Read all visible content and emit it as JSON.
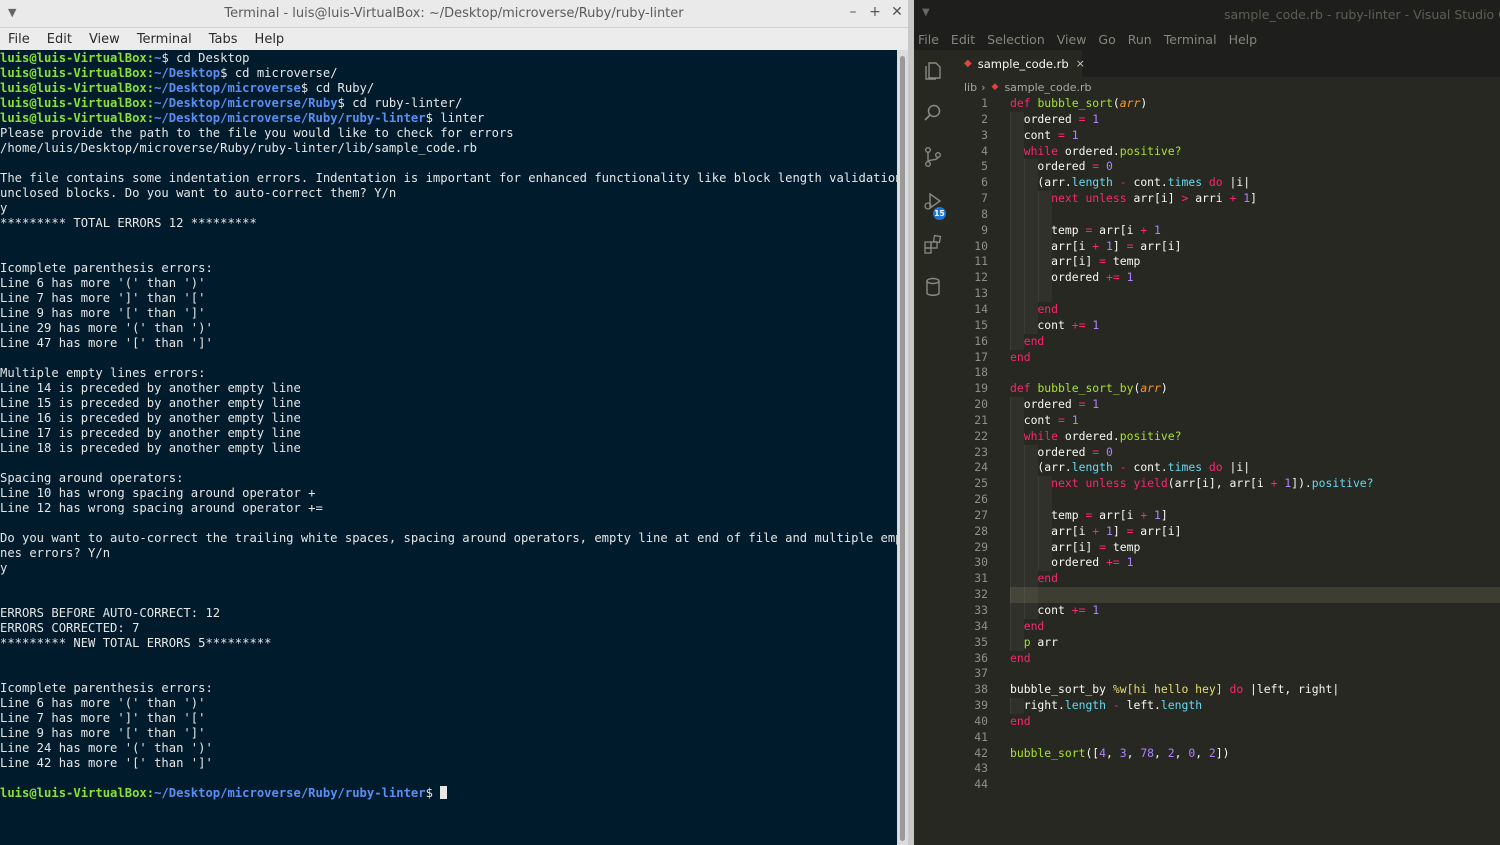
{
  "terminal": {
    "title": "Terminal - luis@luis-VirtualBox: ~/Desktop/microverse/Ruby/ruby-linter",
    "menu": [
      "File",
      "Edit",
      "View",
      "Terminal",
      "Tabs",
      "Help"
    ],
    "lines": [
      {
        "type": "prompt",
        "user": "luis@luis-VirtualBox",
        "path": "~",
        "cmd": "cd Desktop"
      },
      {
        "type": "prompt",
        "user": "luis@luis-VirtualBox",
        "path": "~/Desktop",
        "cmd": "cd microverse/"
      },
      {
        "type": "prompt",
        "user": "luis@luis-VirtualBox",
        "path": "~/Desktop/microverse",
        "cmd": "cd Ruby/"
      },
      {
        "type": "prompt",
        "user": "luis@luis-VirtualBox",
        "path": "~/Desktop/microverse/Ruby",
        "cmd": "cd ruby-linter/"
      },
      {
        "type": "prompt",
        "user": "luis@luis-VirtualBox",
        "path": "~/Desktop/microverse/Ruby/ruby-linter",
        "cmd": "linter"
      },
      {
        "type": "text",
        "text": "Please provide the path to the file you would like to check for errors"
      },
      {
        "type": "text",
        "text": "/home/luis/Desktop/microverse/Ruby/ruby-linter/lib/sample_code.rb"
      },
      {
        "type": "text",
        "text": ""
      },
      {
        "type": "text",
        "text": "The file contains some indentation errors. Indentation is important for enhanced functionality like block length validation and"
      },
      {
        "type": "text",
        "text": "unclosed blocks. Do you want to auto-correct them? Y/n"
      },
      {
        "type": "text",
        "text": "y"
      },
      {
        "type": "text",
        "text": "********* TOTAL ERRORS 12 *********"
      },
      {
        "type": "text",
        "text": ""
      },
      {
        "type": "text",
        "text": ""
      },
      {
        "type": "text",
        "text": "Icomplete parenthesis errors:"
      },
      {
        "type": "text",
        "text": "Line 6 has more '(' than ')'"
      },
      {
        "type": "text",
        "text": "Line 7 has more ']' than '['"
      },
      {
        "type": "text",
        "text": "Line 9 has more '[' than ']'"
      },
      {
        "type": "text",
        "text": "Line 29 has more '(' than ')'"
      },
      {
        "type": "text",
        "text": "Line 47 has more '[' than ']'"
      },
      {
        "type": "text",
        "text": ""
      },
      {
        "type": "text",
        "text": "Multiple empty lines errors:"
      },
      {
        "type": "text",
        "text": "Line 14 is preceded by another empty line"
      },
      {
        "type": "text",
        "text": "Line 15 is preceded by another empty line"
      },
      {
        "type": "text",
        "text": "Line 16 is preceded by another empty line"
      },
      {
        "type": "text",
        "text": "Line 17 is preceded by another empty line"
      },
      {
        "type": "text",
        "text": "Line 18 is preceded by another empty line"
      },
      {
        "type": "text",
        "text": ""
      },
      {
        "type": "text",
        "text": "Spacing around operators:"
      },
      {
        "type": "text",
        "text": "Line 10 has wrong spacing around operator +"
      },
      {
        "type": "text",
        "text": "Line 12 has wrong spacing around operator +="
      },
      {
        "type": "text",
        "text": ""
      },
      {
        "type": "text",
        "text": "Do you want to auto-correct the trailing white spaces, spacing around operators, empty line at end of file and multiple empty li"
      },
      {
        "type": "text",
        "text": "nes errors? Y/n"
      },
      {
        "type": "text",
        "text": "y"
      },
      {
        "type": "text",
        "text": ""
      },
      {
        "type": "text",
        "text": ""
      },
      {
        "type": "text",
        "text": "ERRORS BEFORE AUTO-CORRECT: 12"
      },
      {
        "type": "text",
        "text": "ERRORS CORRECTED: 7"
      },
      {
        "type": "text",
        "text": "********* NEW TOTAL ERRORS 5*********"
      },
      {
        "type": "text",
        "text": ""
      },
      {
        "type": "text",
        "text": ""
      },
      {
        "type": "text",
        "text": "Icomplete parenthesis errors:"
      },
      {
        "type": "text",
        "text": "Line 6 has more '(' than ')'"
      },
      {
        "type": "text",
        "text": "Line 7 has more ']' than '['"
      },
      {
        "type": "text",
        "text": "Line 9 has more '[' than ']'"
      },
      {
        "type": "text",
        "text": "Line 24 has more '(' than ')'"
      },
      {
        "type": "text",
        "text": "Line 42 has more '[' than ']'"
      },
      {
        "type": "text",
        "text": ""
      },
      {
        "type": "prompt",
        "user": "luis@luis-VirtualBox",
        "path": "~/Desktop/microverse/Ruby/ruby-linter",
        "cmd": "",
        "cursor": true
      }
    ]
  },
  "vscode": {
    "title": "sample_code.rb - ruby-linter - Visual Studio Co",
    "menu": [
      "File",
      "Edit",
      "Selection",
      "View",
      "Go",
      "Run",
      "Terminal",
      "Help"
    ],
    "tab": {
      "name": "sample_code.rb",
      "close": "×"
    },
    "breadcrumbs": {
      "folder": "lib",
      "file": "sample_code.rb"
    },
    "source_control_badge": "15",
    "current_line": 32,
    "code_lines": [
      [
        {
          "t": "def ",
          "c": "kw"
        },
        {
          "t": "bubble_sort",
          "c": "fn"
        },
        {
          "t": "("
        },
        {
          "t": "arr",
          "c": "pa"
        },
        {
          "t": ")"
        }
      ],
      [
        {
          "t": "  ordered "
        },
        {
          "t": "=",
          "c": "op"
        },
        {
          "t": " "
        },
        {
          "t": "1",
          "c": "nu"
        }
      ],
      [
        {
          "t": "  cont "
        },
        {
          "t": "=",
          "c": "op"
        },
        {
          "t": " "
        },
        {
          "t": "1",
          "c": "nu"
        }
      ],
      [
        {
          "t": "  "
        },
        {
          "t": "while",
          "c": "kw"
        },
        {
          "t": " ordered."
        },
        {
          "t": "positive?",
          "c": "fn"
        }
      ],
      [
        {
          "t": "    ordered "
        },
        {
          "t": "=",
          "c": "op"
        },
        {
          "t": " "
        },
        {
          "t": "0",
          "c": "nu"
        }
      ],
      [
        {
          "t": "    (arr."
        },
        {
          "t": "length",
          "c": "me"
        },
        {
          "t": " "
        },
        {
          "t": "-",
          "c": "op"
        },
        {
          "t": " cont."
        },
        {
          "t": "times",
          "c": "me"
        },
        {
          "t": " "
        },
        {
          "t": "do",
          "c": "kw"
        },
        {
          "t": " |i|"
        }
      ],
      [
        {
          "t": "      "
        },
        {
          "t": "next",
          "c": "kw"
        },
        {
          "t": " "
        },
        {
          "t": "unless",
          "c": "kw"
        },
        {
          "t": " arr[i] "
        },
        {
          "t": ">",
          "c": "op"
        },
        {
          "t": " arri "
        },
        {
          "t": "+",
          "c": "op"
        },
        {
          "t": " "
        },
        {
          "t": "1",
          "c": "nu"
        },
        {
          "t": "]"
        }
      ],
      [
        {
          "t": ""
        }
      ],
      [
        {
          "t": "      temp "
        },
        {
          "t": "=",
          "c": "op"
        },
        {
          "t": " arr[i "
        },
        {
          "t": "+",
          "c": "op"
        },
        {
          "t": " "
        },
        {
          "t": "1",
          "c": "nu"
        }
      ],
      [
        {
          "t": "      arr[i "
        },
        {
          "t": "+",
          "c": "op"
        },
        {
          "t": " "
        },
        {
          "t": "1",
          "c": "nu"
        },
        {
          "t": "] "
        },
        {
          "t": "=",
          "c": "op"
        },
        {
          "t": " arr[i]"
        }
      ],
      [
        {
          "t": "      arr[i] "
        },
        {
          "t": "=",
          "c": "op"
        },
        {
          "t": " temp"
        }
      ],
      [
        {
          "t": "      ordered "
        },
        {
          "t": "+=",
          "c": "op"
        },
        {
          "t": " "
        },
        {
          "t": "1",
          "c": "nu"
        }
      ],
      [
        {
          "t": ""
        }
      ],
      [
        {
          "t": "    "
        },
        {
          "t": "end",
          "c": "kw"
        }
      ],
      [
        {
          "t": "    cont "
        },
        {
          "t": "+=",
          "c": "op"
        },
        {
          "t": " "
        },
        {
          "t": "1",
          "c": "nu"
        }
      ],
      [
        {
          "t": "  "
        },
        {
          "t": "end",
          "c": "kw"
        }
      ],
      [
        {
          "t": "end",
          "c": "kw"
        }
      ],
      [
        {
          "t": ""
        }
      ],
      [
        {
          "t": "def ",
          "c": "kw"
        },
        {
          "t": "bubble_sort_by",
          "c": "fn"
        },
        {
          "t": "("
        },
        {
          "t": "arr",
          "c": "pa"
        },
        {
          "t": ")"
        }
      ],
      [
        {
          "t": "  ordered "
        },
        {
          "t": "=",
          "c": "op"
        },
        {
          "t": " "
        },
        {
          "t": "1",
          "c": "nu"
        }
      ],
      [
        {
          "t": "  cont "
        },
        {
          "t": "=",
          "c": "op"
        },
        {
          "t": " "
        },
        {
          "t": "1",
          "c": "nu"
        }
      ],
      [
        {
          "t": "  "
        },
        {
          "t": "while",
          "c": "kw"
        },
        {
          "t": " ordered."
        },
        {
          "t": "positive?",
          "c": "fn"
        }
      ],
      [
        {
          "t": "    ordered "
        },
        {
          "t": "=",
          "c": "op"
        },
        {
          "t": " "
        },
        {
          "t": "0",
          "c": "nu"
        }
      ],
      [
        {
          "t": "    (arr."
        },
        {
          "t": "length",
          "c": "me"
        },
        {
          "t": " "
        },
        {
          "t": "-",
          "c": "op"
        },
        {
          "t": " cont."
        },
        {
          "t": "times",
          "c": "me"
        },
        {
          "t": " "
        },
        {
          "t": "do",
          "c": "kw"
        },
        {
          "t": " |i|"
        }
      ],
      [
        {
          "t": "      "
        },
        {
          "t": "next",
          "c": "kw"
        },
        {
          "t": " "
        },
        {
          "t": "unless",
          "c": "kw"
        },
        {
          "t": " "
        },
        {
          "t": "yield",
          "c": "kw"
        },
        {
          "t": "(arr[i], arr[i "
        },
        {
          "t": "+",
          "c": "op"
        },
        {
          "t": " "
        },
        {
          "t": "1",
          "c": "nu"
        },
        {
          "t": "])."
        },
        {
          "t": "positive?",
          "c": "me"
        }
      ],
      [
        {
          "t": ""
        }
      ],
      [
        {
          "t": "      temp "
        },
        {
          "t": "=",
          "c": "op"
        },
        {
          "t": " arr[i "
        },
        {
          "t": "+",
          "c": "op"
        },
        {
          "t": " "
        },
        {
          "t": "1",
          "c": "nu"
        },
        {
          "t": "]"
        }
      ],
      [
        {
          "t": "      arr[i "
        },
        {
          "t": "+",
          "c": "op"
        },
        {
          "t": " "
        },
        {
          "t": "1",
          "c": "nu"
        },
        {
          "t": "] "
        },
        {
          "t": "=",
          "c": "op"
        },
        {
          "t": " arr[i]"
        }
      ],
      [
        {
          "t": "      arr[i] "
        },
        {
          "t": "=",
          "c": "op"
        },
        {
          "t": " temp"
        }
      ],
      [
        {
          "t": "      ordered "
        },
        {
          "t": "+=",
          "c": "op"
        },
        {
          "t": " "
        },
        {
          "t": "1",
          "c": "nu"
        }
      ],
      [
        {
          "t": "    "
        },
        {
          "t": "end",
          "c": "kw"
        }
      ],
      [
        {
          "t": ""
        }
      ],
      [
        {
          "t": "    cont "
        },
        {
          "t": "+=",
          "c": "op"
        },
        {
          "t": " "
        },
        {
          "t": "1",
          "c": "nu"
        }
      ],
      [
        {
          "t": "  "
        },
        {
          "t": "end",
          "c": "kw"
        }
      ],
      [
        {
          "t": "  "
        },
        {
          "t": "p",
          "c": "fn"
        },
        {
          "t": " arr"
        }
      ],
      [
        {
          "t": "end",
          "c": "kw"
        }
      ],
      [
        {
          "t": ""
        }
      ],
      [
        {
          "t": "bubble_sort_by "
        },
        {
          "t": "%w[hi hello hey]",
          "c": "st"
        },
        {
          "t": " "
        },
        {
          "t": "do",
          "c": "kw"
        },
        {
          "t": " |left, right|"
        }
      ],
      [
        {
          "t": "  right."
        },
        {
          "t": "length",
          "c": "me"
        },
        {
          "t": " "
        },
        {
          "t": "-",
          "c": "op"
        },
        {
          "t": " left."
        },
        {
          "t": "length",
          "c": "me"
        }
      ],
      [
        {
          "t": "end",
          "c": "kw"
        }
      ],
      [
        {
          "t": ""
        }
      ],
      [
        {
          "t": "bubble_sort",
          "c": "fn"
        },
        {
          "t": "(["
        },
        {
          "t": "4",
          "c": "nu"
        },
        {
          "t": ", "
        },
        {
          "t": "3",
          "c": "nu"
        },
        {
          "t": ", "
        },
        {
          "t": "78",
          "c": "nu"
        },
        {
          "t": ", "
        },
        {
          "t": "2",
          "c": "nu"
        },
        {
          "t": ", "
        },
        {
          "t": "0",
          "c": "nu"
        },
        {
          "t": ", "
        },
        {
          "t": "2",
          "c": "nu"
        },
        {
          "t": "])"
        }
      ],
      [
        {
          "t": ""
        }
      ],
      [
        {
          "t": ""
        }
      ]
    ],
    "indent_guides": [
      0,
      1,
      1,
      1,
      2,
      2,
      3,
      3,
      3,
      3,
      3,
      3,
      3,
      2,
      2,
      1,
      0,
      0,
      0,
      1,
      1,
      1,
      2,
      2,
      3,
      3,
      3,
      3,
      3,
      3,
      2,
      2,
      2,
      1,
      1,
      0,
      0,
      0,
      1,
      0,
      0,
      0,
      0,
      0
    ],
    "colors": {
      "keyword": "#f92672",
      "function": "#a6e22e",
      "number": "#ae81ff",
      "method": "#66d9ef",
      "string": "#e6db74",
      "background": "#272822"
    }
  }
}
